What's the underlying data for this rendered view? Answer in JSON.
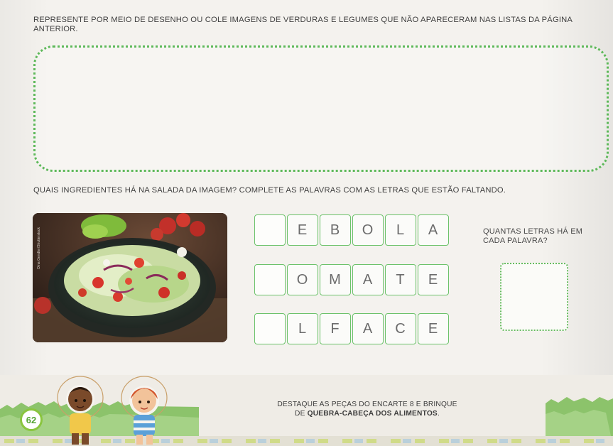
{
  "activity": {
    "instruction": "REPRESENTE POR MEIO DE DESENHO OU COLE IMAGENS DE VERDURAS E LEGUMES QUE NÃO APARECERAM NAS LISTAS DA PÁGINA ANTERIOR.",
    "question": "QUAIS INGREDIENTES HÁ NA SALADA DA IMAGEM? COMPLETE AS PALAVRAS COM AS LETRAS QUE ESTÃO FALTANDO.",
    "photo_credit": "Dina Gendler/Shutterstock",
    "words": [
      [
        "",
        "E",
        "B",
        "O",
        "L",
        "A"
      ],
      [
        "",
        "O",
        "M",
        "A",
        "T",
        "E"
      ],
      [
        "",
        "L",
        "F",
        "A",
        "C",
        "E"
      ]
    ],
    "count_question": "QUANTAS LETRAS HÁ EM CADA PALAVRA?"
  },
  "footer": {
    "text_line1": "DESTAQUE AS PEÇAS DO ENCARTE 8 E BRINQUE",
    "text_prefix": "DE ",
    "text_bold": "QUEBRA-CABEÇA DOS ALIMENTOS",
    "text_suffix": ".",
    "page_number": "62"
  },
  "colors": {
    "accent_green": "#5eb95a",
    "page_number_green": "#8ac53f"
  }
}
